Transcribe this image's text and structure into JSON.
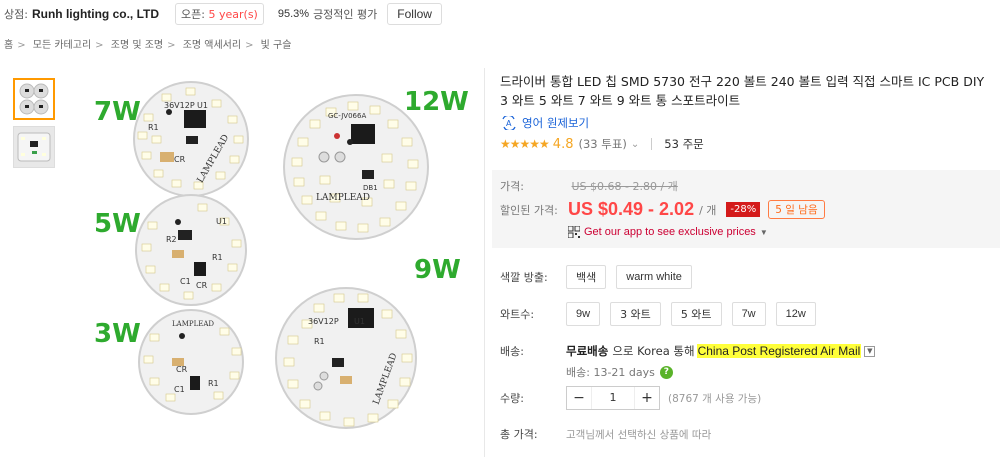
{
  "store": {
    "label": "상점:",
    "name": "Runh lighting co., LTD",
    "open_label": "오픈:",
    "open_years": "5 year(s)",
    "feedback_pct": "95.3%",
    "feedback_text": "긍정적인 평가",
    "follow": "Follow"
  },
  "breadcrumb": [
    "홈",
    "모든 카테고리",
    "조명 및 조명",
    "조명 액세서리",
    "빛 구슬"
  ],
  "gallery": {
    "labels": {
      "w7": "7W",
      "w12": "12W",
      "w5": "5W",
      "w9": "9W",
      "w3": "3W"
    },
    "pcb_marks": {
      "p7": "36V12P",
      "p12": "GC-JV066A",
      "p9": "36V12P",
      "brand": "LAMPLEAD",
      "u1": "U1",
      "r1": "R1",
      "r2": "R2",
      "c1": "C1",
      "cr": "CR",
      "db1": "DB1"
    }
  },
  "product": {
    "title": "드라이버 통합 LED 칩 SMD 5730 전구 220 볼트 240 볼트 입력 직접 스마트 IC PCB DIY 3 와트 5 와트 7 와트 9 와트 통 스포트라이트",
    "translate": "영어 원제보기",
    "rating": "4.8",
    "votes": "(33 투표)",
    "orders": "53 주문"
  },
  "price": {
    "orig_label": "가격:",
    "orig": "US $0.68 - 2.80 / 개",
    "disc_label": "할인된 가격:",
    "disc": "US $0.49 - 2.02",
    "per": "/ 개",
    "off": "-28%",
    "days_left": "5 일 남음",
    "app_promo": "Get our app to see exclusive prices"
  },
  "options": {
    "color_label": "색깔 방출:",
    "colors": [
      "백색",
      "warm white"
    ],
    "watt_label": "와트수:",
    "watts": [
      "9w",
      "3 와트",
      "5 와트",
      "7w",
      "12w"
    ]
  },
  "shipping": {
    "label": "배송:",
    "free": "무료배송",
    "via": "으로 Korea 통해",
    "method": "China Post Registered Air Mail",
    "days": "배송: 13-21 days"
  },
  "quantity": {
    "label": "수량:",
    "value": "1",
    "available": "(8767 개 사용 가능)"
  },
  "total": {
    "label": "총 가격:",
    "text": "고객님께서 선택하신 상품에 따라"
  },
  "colors": {
    "accent_red": "#ff4747",
    "star": "#f5a623",
    "green_label": "#2eaa2e",
    "highlight": "#ffff3a"
  }
}
